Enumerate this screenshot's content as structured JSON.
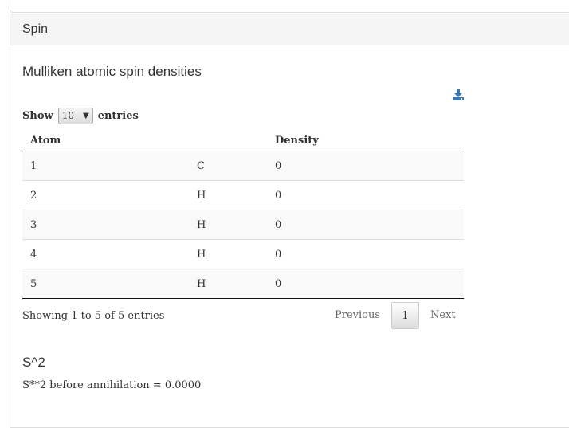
{
  "panel": {
    "heading": "Spin"
  },
  "section": {
    "title": "Mulliken atomic spin densities"
  },
  "icons": {
    "download": "download-icon"
  },
  "length": {
    "show_label": "Show",
    "selected": "10",
    "entries_label": "entries"
  },
  "table": {
    "columns": [
      "Atom",
      "",
      "Density"
    ],
    "rows": [
      [
        "1",
        "C",
        "0"
      ],
      [
        "2",
        "H",
        "0"
      ],
      [
        "3",
        "H",
        "0"
      ],
      [
        "4",
        "H",
        "0"
      ],
      [
        "5",
        "H",
        "0"
      ]
    ]
  },
  "footer": {
    "info": "Showing 1 to 5 of 5 entries",
    "previous": "Previous",
    "current_page": "1",
    "next": "Next"
  },
  "s2": {
    "title": "S^2",
    "text": "S**2 before annihilation = 0.0000"
  },
  "colors": {
    "download_icon": "#3a78b5",
    "header_bg": "#f5f5f5",
    "border": "#dddddd"
  }
}
